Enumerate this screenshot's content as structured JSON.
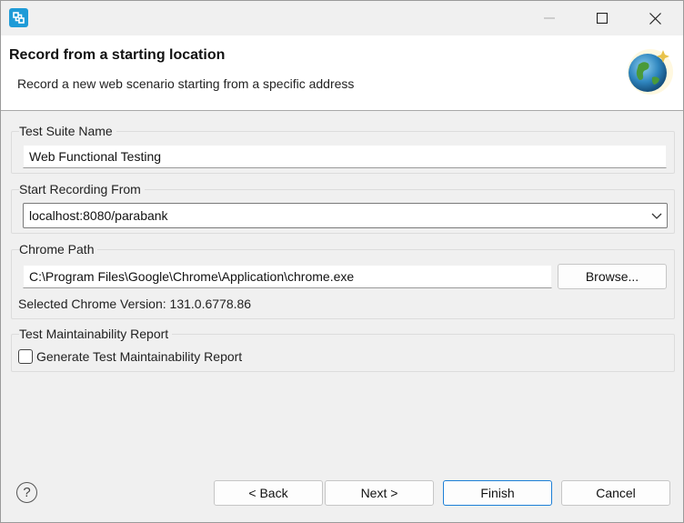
{
  "window": {
    "app_icon": "eclipse-wizard-icon",
    "controls": {
      "minimize": "minimize-icon",
      "maximize": "maximize-icon",
      "close": "close-icon"
    }
  },
  "header": {
    "title": "Record from a starting location",
    "description": "Record a new web scenario starting from a specific address",
    "banner_icon": "globe-icon"
  },
  "test_suite": {
    "label": "Test Suite Name",
    "value": "Web Functional Testing"
  },
  "start_recording": {
    "label": "Start Recording From",
    "selected": "localhost:8080/parabank"
  },
  "chrome": {
    "label": "Chrome Path",
    "path": "C:\\Program Files\\Google\\Chrome\\Application\\chrome.exe",
    "browse_label": "Browse...",
    "version_text": "Selected Chrome Version: 131.0.6778.86"
  },
  "report": {
    "label": "Test Maintainability Report",
    "checkbox_label": "Generate Test Maintainability Report",
    "checked": false
  },
  "footer": {
    "help_label": "?",
    "back_label": "< Back",
    "next_label": "Next >",
    "finish_label": "Finish",
    "cancel_label": "Cancel"
  },
  "colors": {
    "accent": "#1c7fd6",
    "app_icon": "#1f9bd7"
  }
}
